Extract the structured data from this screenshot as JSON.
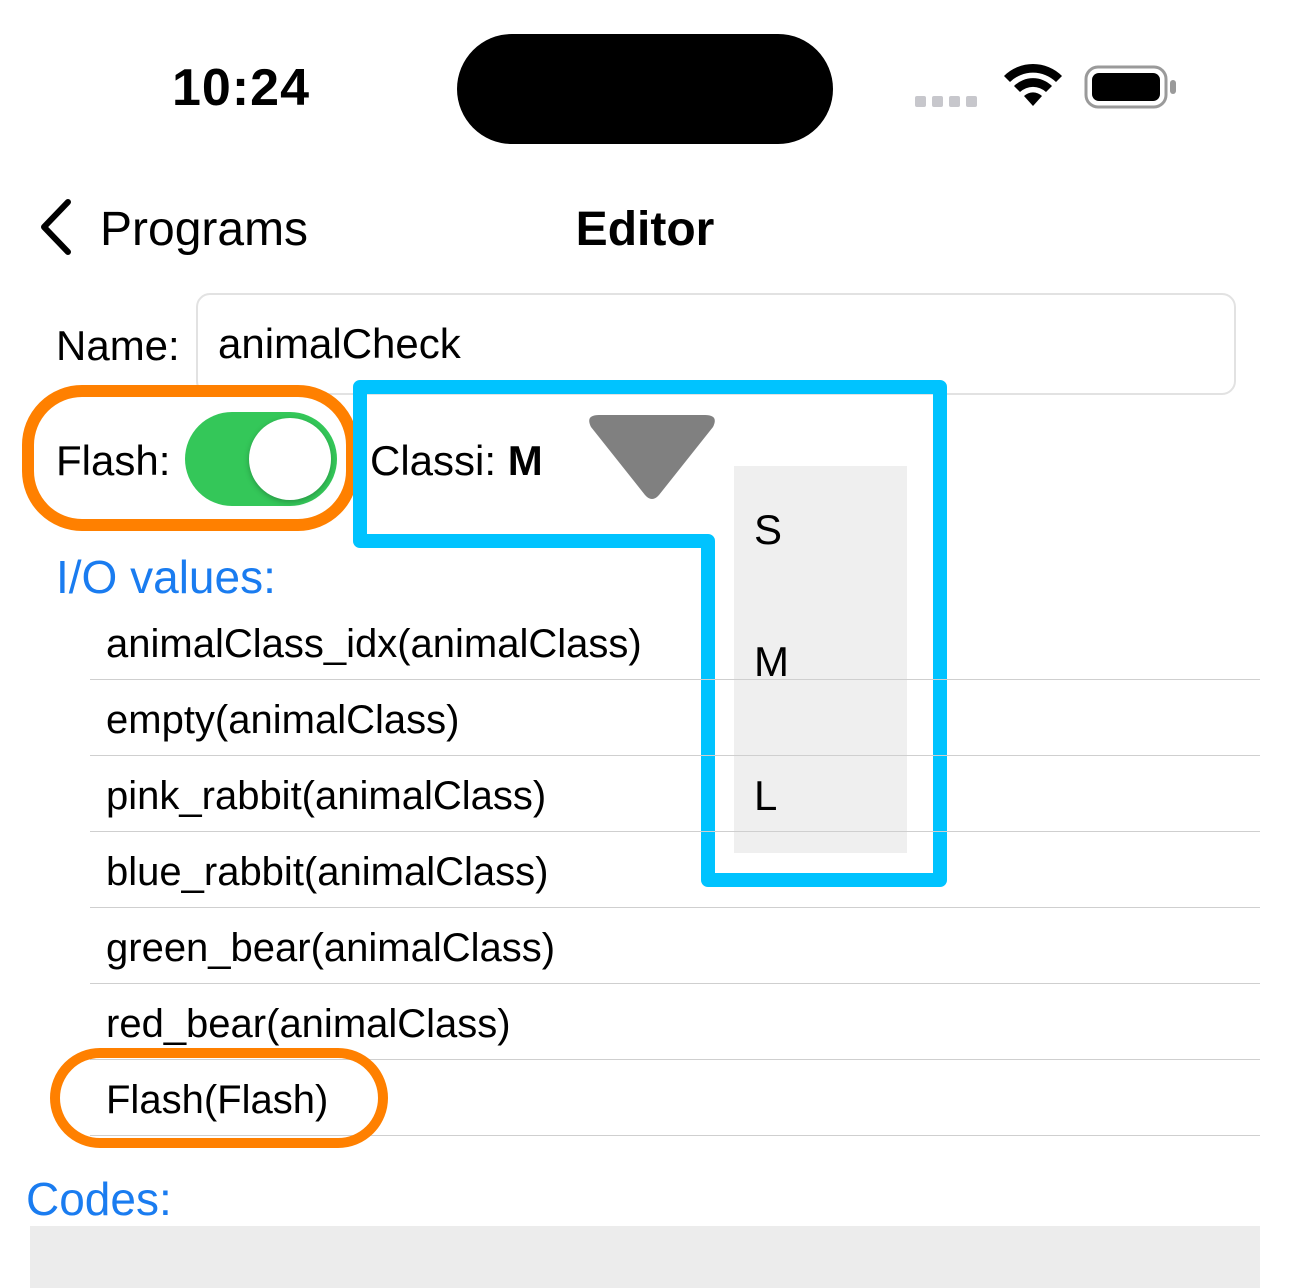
{
  "status_bar": {
    "time": "10:24"
  },
  "nav": {
    "back_label": "Programs",
    "title": "Editor"
  },
  "name_row": {
    "label": "Name:",
    "value": "animalCheck"
  },
  "flash_row": {
    "label": "Flash:",
    "toggle_on": true
  },
  "class_picker": {
    "label": "Classi:",
    "selected": "M",
    "options": [
      "S",
      "M",
      "L"
    ]
  },
  "io_section": {
    "title": "I/O values:",
    "items": [
      "animalClass_idx(animalClass)",
      "empty(animalClass)",
      "pink_rabbit(animalClass)",
      "blue_rabbit(animalClass)",
      "green_bear(animalClass)",
      "red_bear(animalClass)",
      "Flash(Flash)"
    ]
  },
  "codes_section": {
    "title": "Codes:"
  },
  "colors": {
    "accent_blue": "#1a7cf0",
    "toggle_green": "#34c759",
    "highlight_orange": "#ff8000",
    "highlight_cyan": "#00c3ff"
  }
}
